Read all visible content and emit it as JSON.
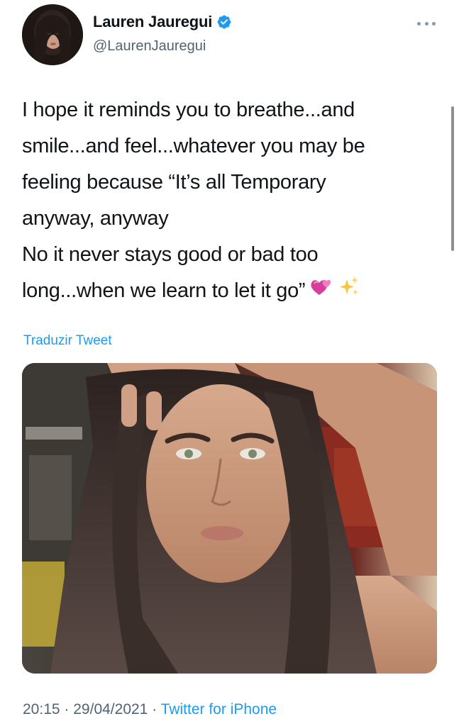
{
  "author": {
    "display_name": "Lauren Jauregui",
    "handle": "@LaurenJauregui",
    "verified": true,
    "avatar_icon": "profile-photo"
  },
  "header": {
    "more_icon": "more-horizontal-icon"
  },
  "tweet": {
    "lines": [
      "I hope it reminds you to breathe...and",
      "smile...and feel...whatever you may be",
      "feeling because “It’s all Temporary",
      "anyway, anyway",
      "No it never stays good or bad too",
      "long...when we learn to let it go”"
    ],
    "trailing_emoji": [
      "two-hearts-emoji",
      "sparkles-emoji"
    ]
  },
  "translate_label": "Traduzir Tweet",
  "media": {
    "type": "photo",
    "icon": "selfie-photo"
  },
  "meta": {
    "time": "20:15",
    "separator": "·",
    "date": "29/04/2021",
    "source": "Twitter for iPhone"
  },
  "colors": {
    "link": "#1d9bf0",
    "secondary_text": "#536471",
    "primary_text": "#0f1419"
  }
}
